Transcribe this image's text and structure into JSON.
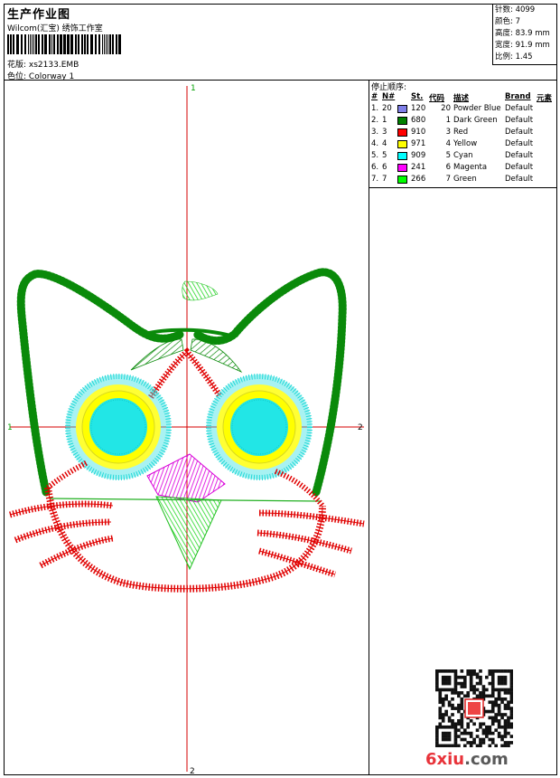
{
  "header": {
    "title": "生产作业图",
    "studio": "Wilcom(汇宝) 绣饰工作室",
    "design_label": "花版:",
    "design_value": "xs2133.EMB",
    "colorway_label": "色位:",
    "colorway_value": "Colorway 1"
  },
  "stats": {
    "stitches_label": "针数:",
    "stitches_value": "4099",
    "colors_label": "颜色:",
    "colors_value": "7",
    "height_label": "高度:",
    "height_value": "83.9 mm",
    "width_label": "宽度:",
    "width_value": "91.9 mm",
    "scale_label": "比例:",
    "scale_value": "1.45"
  },
  "axes": {
    "top": "1",
    "bottom": "2",
    "left": "1",
    "right": "2"
  },
  "stop_sequence": {
    "title": "停止顺序:",
    "columns": [
      "#",
      "N#",
      "St.",
      "代码",
      "描述",
      "Brand",
      "元素"
    ],
    "rows": [
      {
        "index": "1.",
        "n": "20",
        "color": "#7f7fe8",
        "code": "120",
        "num": "20",
        "desc": "Powder Blue",
        "brand": "Default"
      },
      {
        "index": "2.",
        "n": "1",
        "color": "#008000",
        "code": "680",
        "num": "1",
        "desc": "Dark Green",
        "brand": "Default"
      },
      {
        "index": "3.",
        "n": "3",
        "color": "#ff0000",
        "code": "910",
        "num": "3",
        "desc": "Red",
        "brand": "Default"
      },
      {
        "index": "4.",
        "n": "4",
        "color": "#ffff00",
        "code": "971",
        "num": "4",
        "desc": "Yellow",
        "brand": "Default"
      },
      {
        "index": "5.",
        "n": "5",
        "color": "#00ffff",
        "code": "909",
        "num": "5",
        "desc": "Cyan",
        "brand": "Default"
      },
      {
        "index": "6.",
        "n": "6",
        "color": "#ff00ff",
        "code": "241",
        "num": "6",
        "desc": "Magenta",
        "brand": "Default"
      },
      {
        "index": "7.",
        "n": "7",
        "color": "#00ff00",
        "code": "266",
        "num": "7",
        "desc": "Green",
        "brand": "Default"
      }
    ]
  },
  "watermark": {
    "part1": "6",
    "part2": "xiu",
    "part3": ".com"
  }
}
